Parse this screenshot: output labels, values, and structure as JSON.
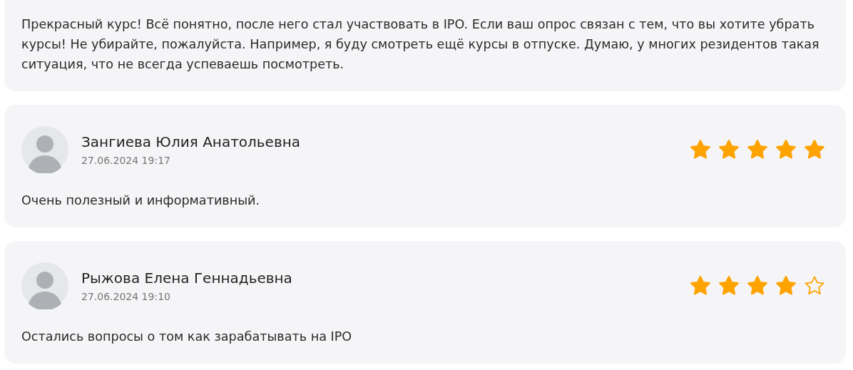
{
  "reviews": [
    {
      "text": "Прекрасный курс! Всё понятно, после него стал участвовать в IPO. Если ваш опрос связан с тем, что вы хотите убрать курсы! Не убирайте, пожалуйста. Например, я буду смотреть ещё курсы в отпуске. Думаю, у многих резидентов такая ситуация, что не всегда успеваешь посмотреть."
    },
    {
      "author": "Зангиева Юлия Анатольевна",
      "date": "27.06.2024 19:17",
      "stars": 5,
      "text": "Очень полезный и информативный."
    },
    {
      "author": "Рыжова Елена Геннадьевна",
      "date": "27.06.2024 19:10",
      "stars": 4,
      "text": "Остались вопросы о том как зарабатывать на IPO"
    }
  ]
}
